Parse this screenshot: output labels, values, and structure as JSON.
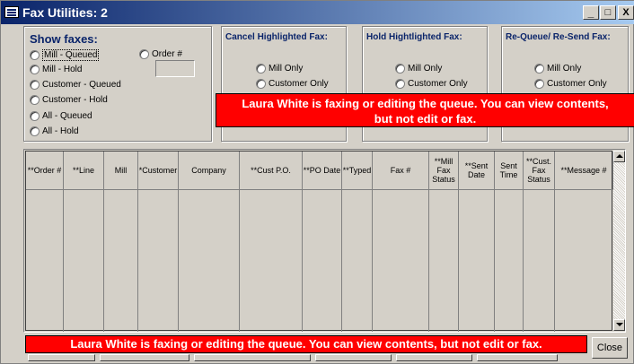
{
  "window": {
    "title": "Fax Utilities: 2",
    "minimize": "_",
    "maximize": "□",
    "close": "X"
  },
  "show_faxes": {
    "title": "Show faxes:",
    "options": [
      "Mill - Queued",
      "Mill - Hold",
      "Customer - Queued",
      "Customer - Hold",
      "All - Queued",
      "All - Hold"
    ],
    "order_label": "Order #",
    "order_value": ""
  },
  "cancel": {
    "title": "Cancel Highlighted Fax:",
    "options": [
      "Mill Only",
      "Customer Only"
    ]
  },
  "hold": {
    "title": "Hold Hightlighted Fax:",
    "options": [
      "Mill Only",
      "Customer Only"
    ]
  },
  "requeue": {
    "title": "Re-Queue/ Re-Send Fax:",
    "options": [
      "Mill Only",
      "Customer Only"
    ]
  },
  "warning": "Laura White is faxing or editing the queue. You can view contents, but not edit or fax.",
  "warning_top_line1": "Laura White is faxing or editing the queue. You can view contents,",
  "warning_top_line2": "but not edit or fax.",
  "grid": {
    "columns": [
      "**Order #",
      "**Line",
      "Mill",
      "*Customer",
      "Company",
      "**Cust P.O.",
      "**PO Date",
      "**Typed",
      "Fax #",
      "**Mill Fax Status",
      "**Sent Date",
      "Sent Time",
      "**Cust. Fax Status",
      "**Message #"
    ]
  },
  "close_button": {
    "label_prefix": "",
    "label_underline": "C",
    "label_rest": "lose"
  },
  "colors": {
    "title_bar": "#0a246a",
    "group_title": "#0a246a",
    "warning_bg": "#ff0000",
    "face": "#d4d0c8"
  }
}
